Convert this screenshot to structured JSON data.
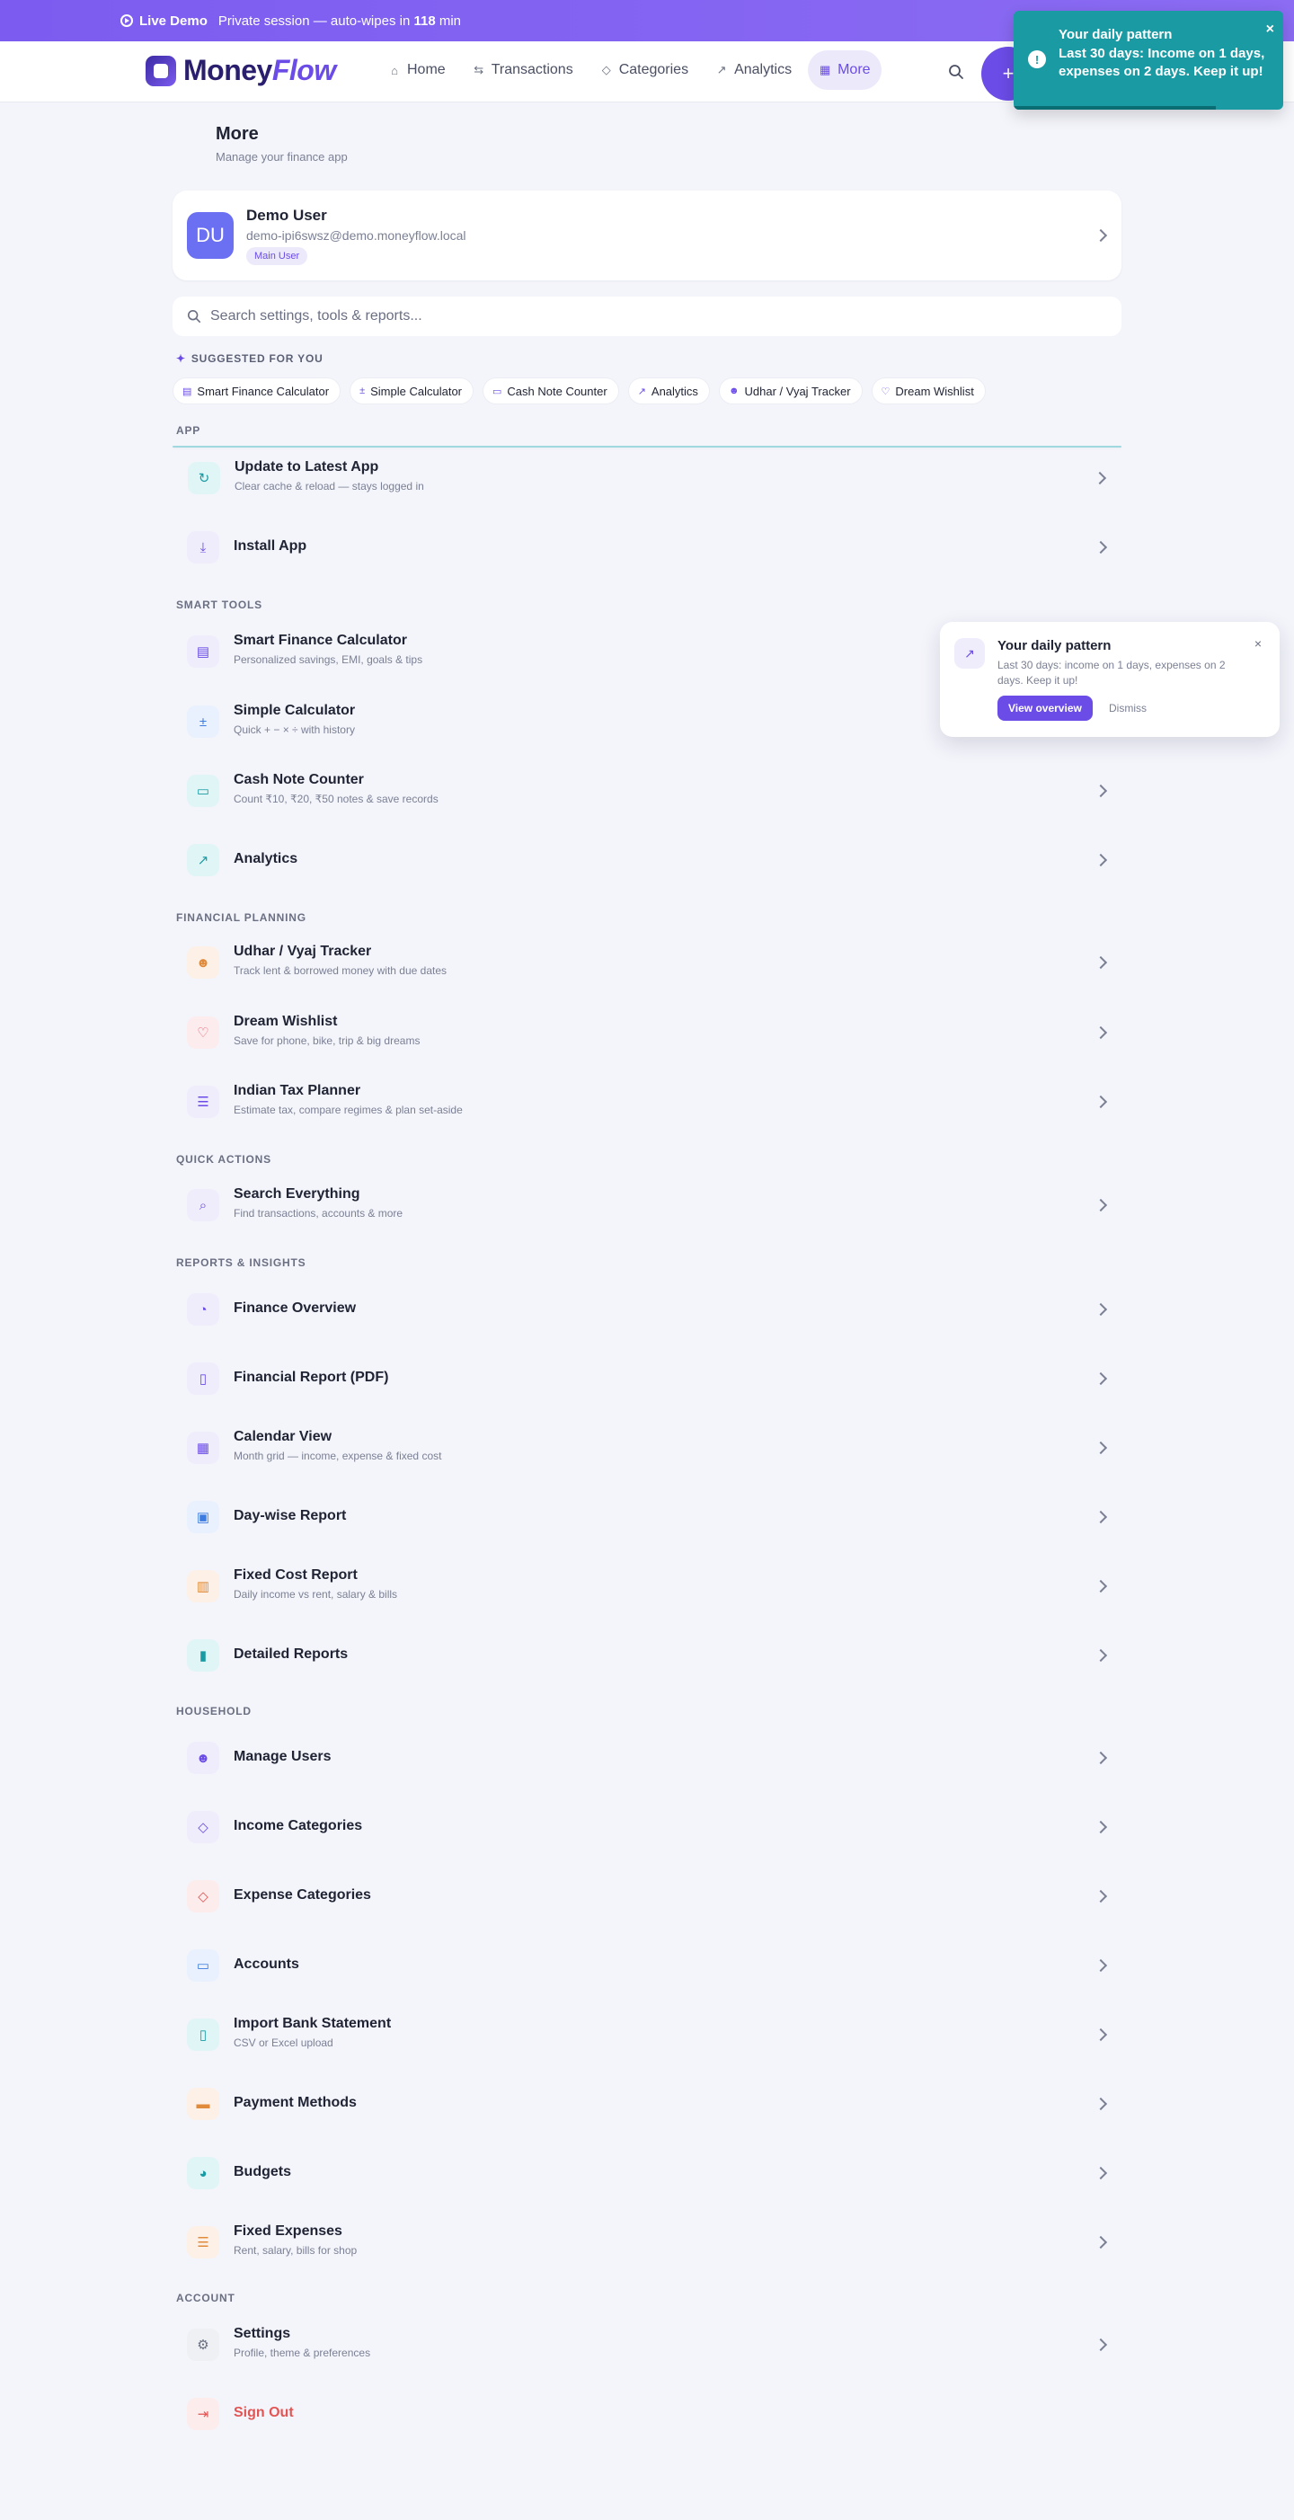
{
  "banner": {
    "live_label": "Live Demo",
    "text_prefix": "Private session — auto-wipes in",
    "minutes": "118",
    "minutes_unit": "min"
  },
  "nav": {
    "logo_text_a": "Money",
    "logo_text_b": "Flow",
    "links": [
      {
        "label": "Home",
        "icon": "home-icon"
      },
      {
        "label": "Transactions",
        "icon": "transactions-icon"
      },
      {
        "label": "Categories",
        "icon": "tag-icon"
      },
      {
        "label": "Analytics",
        "icon": "chart-icon"
      },
      {
        "label": "More",
        "icon": "grid-icon",
        "active": true
      }
    ],
    "add_label": "+"
  },
  "toast": {
    "title": "Your daily pattern",
    "message": "Last 30 days: Income on 1 days, expenses on 2 days. Keep it up!",
    "close": "×",
    "progress": 0.75
  },
  "page": {
    "title": "More",
    "subtitle": "Manage your finance app"
  },
  "profile": {
    "initials": "DU",
    "name": "Demo User",
    "email": "demo-ipi6swsz@demo.moneyflow.local",
    "badge": "Main User"
  },
  "search": {
    "placeholder": "Search settings, tools & reports..."
  },
  "suggested": {
    "heading": "SUGGESTED FOR YOU",
    "chips": [
      "Smart Finance Calculator",
      "Simple Calculator",
      "Cash Note Counter",
      "Analytics",
      "Udhar / Vyaj Tracker",
      "Dream Wishlist"
    ]
  },
  "sections": {
    "app": "APP",
    "smart_tools": "SMART TOOLS",
    "financial_planning": "FINANCIAL PLANNING",
    "quick_actions": "QUICK ACTIONS",
    "reports": "REPORTS & INSIGHTS",
    "household": "HOUSEHOLD",
    "account": "ACCOUNT"
  },
  "items": {
    "update_app": {
      "title": "Update to Latest App",
      "sub": "Clear cache & reload — stays logged in"
    },
    "install_app": {
      "title": "Install App"
    },
    "smart_calc": {
      "title": "Smart Finance Calculator",
      "sub": "Personalized savings, EMI, goals & tips"
    },
    "simple_calc": {
      "title": "Simple Calculator",
      "sub": "Quick + − × ÷ with history"
    },
    "cash_counter": {
      "title": "Cash Note Counter",
      "sub": "Count ₹10, ₹20, ₹50 notes & save records"
    },
    "analytics": {
      "title": "Analytics"
    },
    "udhar": {
      "title": "Udhar / Vyaj Tracker",
      "sub": "Track lent & borrowed money with due dates"
    },
    "wishlist": {
      "title": "Dream Wishlist",
      "sub": "Save for phone, bike, trip & big dreams"
    },
    "tax": {
      "title": "Indian Tax Planner",
      "sub": "Estimate tax, compare regimes & plan set-aside"
    },
    "search_all": {
      "title": "Search Everything",
      "sub": "Find transactions, accounts & more"
    },
    "finance_overview": {
      "title": "Finance Overview"
    },
    "financial_report": {
      "title": "Financial Report (PDF)"
    },
    "calendar": {
      "title": "Calendar View",
      "sub": "Month grid — income, expense & fixed cost"
    },
    "daywise": {
      "title": "Day-wise Report"
    },
    "fixed_cost": {
      "title": "Fixed Cost Report",
      "sub": "Daily income vs rent, salary & bills"
    },
    "detailed": {
      "title": "Detailed Reports"
    },
    "manage_users": {
      "title": "Manage Users"
    },
    "income_cat": {
      "title": "Income Categories"
    },
    "expense_cat": {
      "title": "Expense Categories"
    },
    "accounts": {
      "title": "Accounts"
    },
    "import_bank": {
      "title": "Import Bank Statement",
      "sub": "CSV or Excel upload"
    },
    "payment_methods": {
      "title": "Payment Methods"
    },
    "budgets": {
      "title": "Budgets"
    },
    "fixed_expenses": {
      "title": "Fixed Expenses",
      "sub": "Rent, salary, bills for shop"
    },
    "settings": {
      "title": "Settings",
      "sub": "Profile, theme & preferences"
    },
    "sign_out": {
      "title": "Sign Out"
    }
  },
  "popover": {
    "title": "Your daily pattern",
    "message": "Last 30 days: income on 1 days, expenses on 2 days. Keep it up!",
    "primary": "View overview",
    "dismiss": "Dismiss",
    "close": "×"
  }
}
